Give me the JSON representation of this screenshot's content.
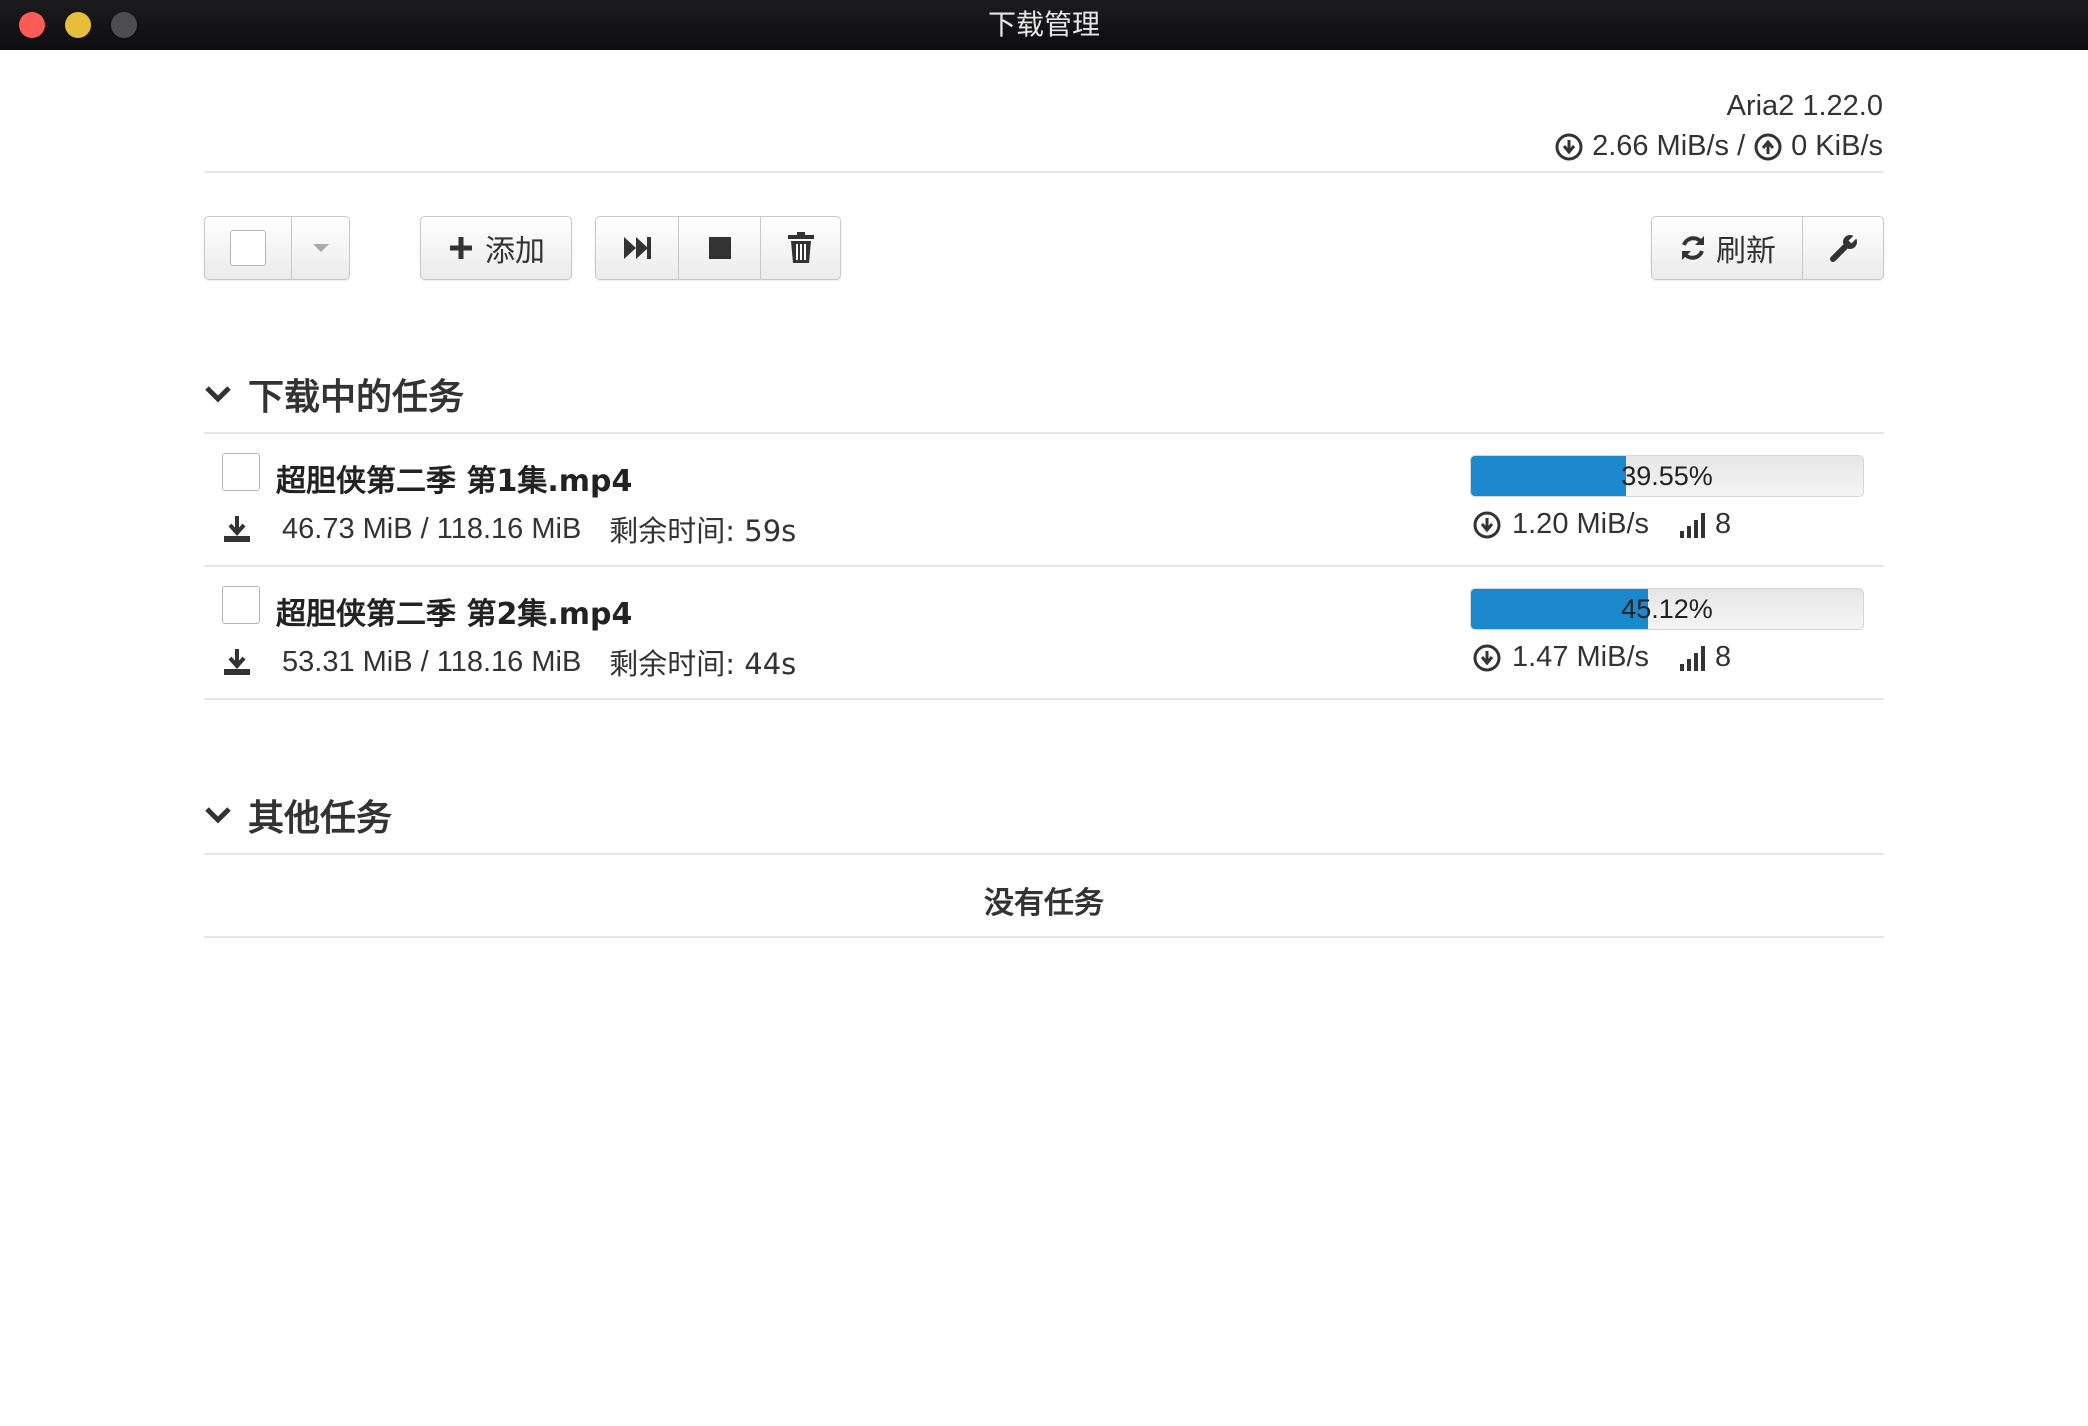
{
  "window": {
    "title": "下载管理",
    "controls": [
      "close",
      "minimize",
      "maximize"
    ]
  },
  "header": {
    "version": "Aria2 1.22.0",
    "download_speed": "2.66 MiB/s",
    "separator": "/",
    "upload_speed": "0 KiB/s",
    "download_icon": "circle-arrow-down-icon",
    "upload_icon": "circle-arrow-up-icon"
  },
  "toolbar": {
    "select_icon": "checkbox",
    "select_dropdown_icon": "caret-down-icon",
    "add_label": "添加",
    "add_icon": "plus-icon",
    "resume_icon": "fast-forward-icon",
    "stop_icon": "stop-icon",
    "delete_icon": "trash-icon",
    "refresh_label": "刷新",
    "refresh_icon": "refresh-icon",
    "settings_icon": "wrench-icon"
  },
  "sections": {
    "active": {
      "title": "下载中的任务",
      "tasks": [
        {
          "name": "超胆侠第二季 第1集.mp4",
          "size": "46.73 MiB / 118.16 MiB",
          "remaining": "剩余时间: 59s",
          "progress_text": "39.55%",
          "progress": 0.3955,
          "speed": "1.20 MiB/s",
          "connections": "8"
        },
        {
          "name": "超胆侠第二季 第2集.mp4",
          "size": "53.31 MiB / 118.16 MiB",
          "remaining": "剩余时间: 44s",
          "progress_text": "45.12%",
          "progress": 0.4512,
          "speed": "1.47 MiB/s",
          "connections": "8"
        }
      ]
    },
    "other": {
      "title": "其他任务",
      "empty_message": "没有任务"
    }
  },
  "colors": {
    "progress_fill": "#1b87cc",
    "close": "#fc5b57",
    "minimize": "#e5bf3c",
    "maximize": "#4d4d50"
  }
}
